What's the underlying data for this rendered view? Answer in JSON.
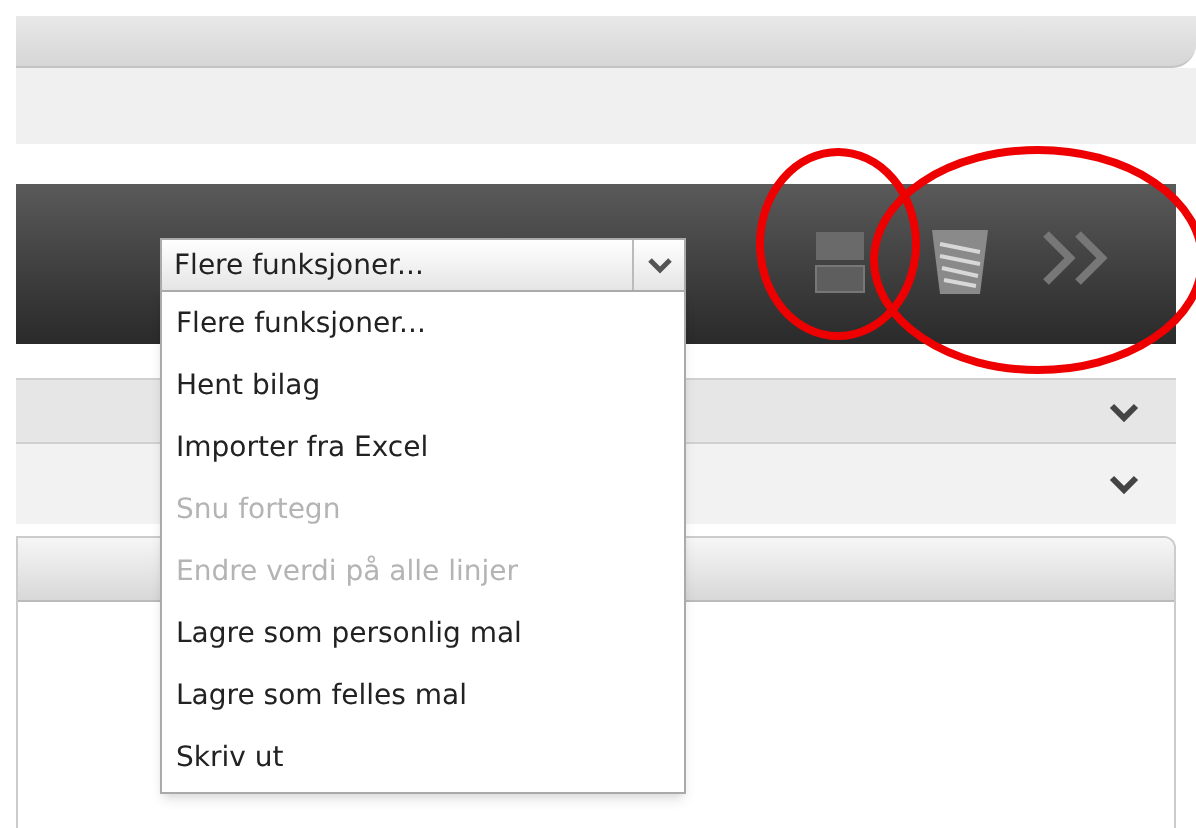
{
  "toolbar": {
    "select": {
      "value": "Flere funksjoner..."
    }
  },
  "menu": {
    "items": [
      {
        "label": "Flere funksjoner...",
        "disabled": false
      },
      {
        "label": "Hent bilag",
        "disabled": false
      },
      {
        "label": "Importer fra Excel",
        "disabled": false
      },
      {
        "label": "Snu fortegn",
        "disabled": true
      },
      {
        "label": "Endre verdi på alle linjer",
        "disabled": true
      },
      {
        "label": "Lagre som personlig mal",
        "disabled": false
      },
      {
        "label": "Lagre som felles mal",
        "disabled": false
      },
      {
        "label": "Skriv ut",
        "disabled": false
      }
    ]
  }
}
